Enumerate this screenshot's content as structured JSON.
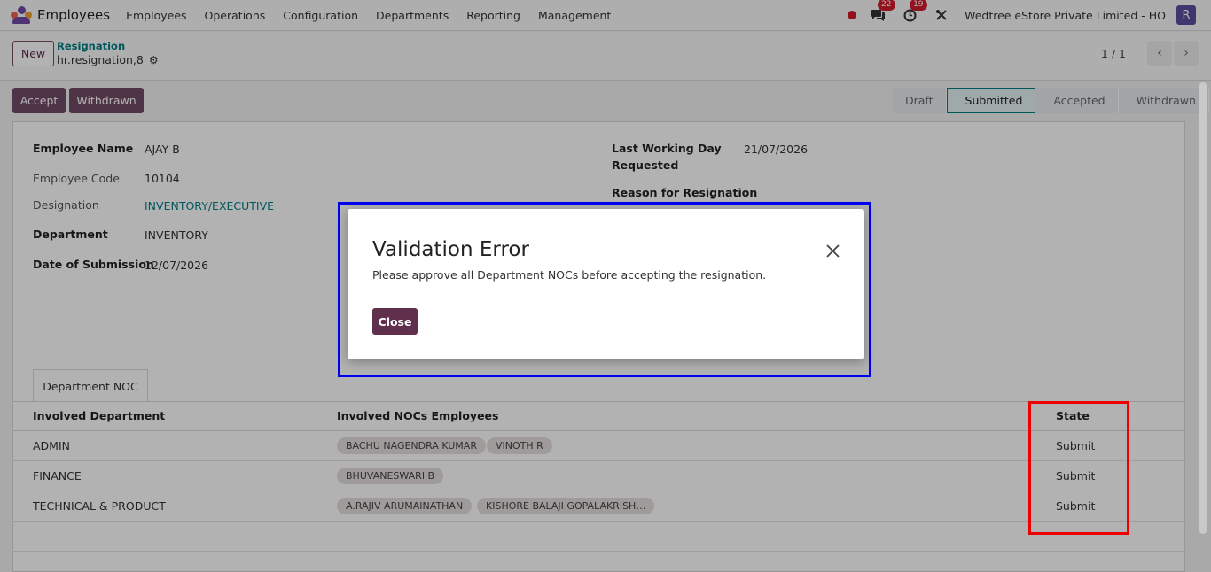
{
  "navbar": {
    "app_name": "Employees",
    "menu": [
      "Employees",
      "Operations",
      "Configuration",
      "Departments",
      "Reporting",
      "Management"
    ],
    "messages_count": "22",
    "activities_count": "19",
    "company": "Wedtree eStore Private Limited - HO",
    "avatar_letter": "R"
  },
  "control": {
    "new_label": "New",
    "breadcrumb_parent": "Resignation",
    "breadcrumb_current": "hr.resignation,8",
    "pager": "1 / 1"
  },
  "actions": {
    "accept_label": "Accept",
    "withdrawn_label": "Withdrawn"
  },
  "statusbar": {
    "stages": [
      "Draft",
      "Submitted",
      "Accepted",
      "Withdrawn"
    ],
    "active": "Submitted"
  },
  "form": {
    "employee_name_label": "Employee Name",
    "employee_name": "AJAY B",
    "employee_code_label": "Employee Code",
    "employee_code": "10104",
    "designation_label": "Designation",
    "designation": "INVENTORY/EXECUTIVE",
    "department_label": "Department",
    "department": "INVENTORY",
    "date_of_submission_label": "Date of Submission",
    "date_of_submission": "12/07/2026",
    "last_working_day_label_1": "Last Working Day",
    "last_working_day_label_2": "Requested",
    "last_working_day": "21/07/2026",
    "reason_label": "Reason for Resignation"
  },
  "noc": {
    "tab_label": "Department NOC",
    "columns": [
      "Involved Department",
      "Involved NOCs Employees",
      "State"
    ],
    "rows": [
      {
        "department": "ADMIN",
        "employees": [
          "BACHU NAGENDRA KUMAR",
          "VINOTH R"
        ],
        "state": "Submit"
      },
      {
        "department": "FINANCE",
        "employees": [
          "BHUVANESWARI B"
        ],
        "state": "Submit"
      },
      {
        "department": "TECHNICAL & PRODUCT",
        "employees": [
          "A.RAJIV ARUMAINATHAN",
          "KISHORE BALAJI GOPALAKRISH…"
        ],
        "state": "Submit"
      }
    ]
  },
  "modal": {
    "title": "Validation Error",
    "message": "Please approve all Department NOCs before accepting the resignation.",
    "close_label": "Close"
  },
  "colors": {
    "brand": "#714b67",
    "accent_teal": "#017e84",
    "highlight_blue": "#0000ee",
    "highlight_red": "#ee0000"
  }
}
